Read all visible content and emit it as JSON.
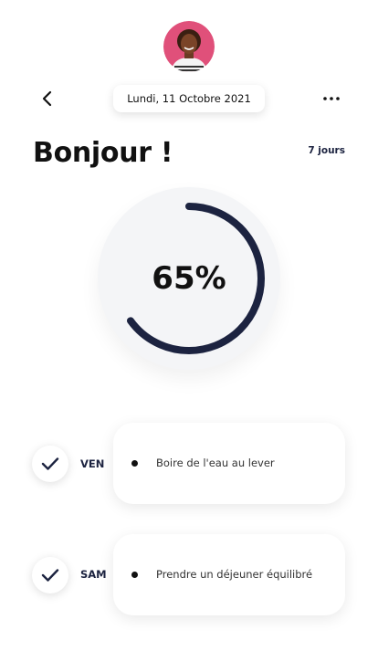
{
  "header": {
    "date_label": "Lundi, 11 Octobre 2021",
    "back_icon": "chevron-left-icon",
    "more_icon": "more-horizontal-icon"
  },
  "greeting": {
    "title": "Bonjour !",
    "period_link": "7 jours"
  },
  "progress": {
    "value_label": "65%",
    "fraction": 0.65,
    "ring_color": "#1c2340",
    "track_color": "#f4f5f7"
  },
  "tasks": [
    {
      "day": "VEN",
      "text": "Boire de l'eau au lever",
      "done": true
    },
    {
      "day": "SAM",
      "text": "Prendre un déjeuner équilibré",
      "done": true
    }
  ],
  "colors": {
    "accent": "#1c2340",
    "avatar_bg": "#e0507a"
  }
}
